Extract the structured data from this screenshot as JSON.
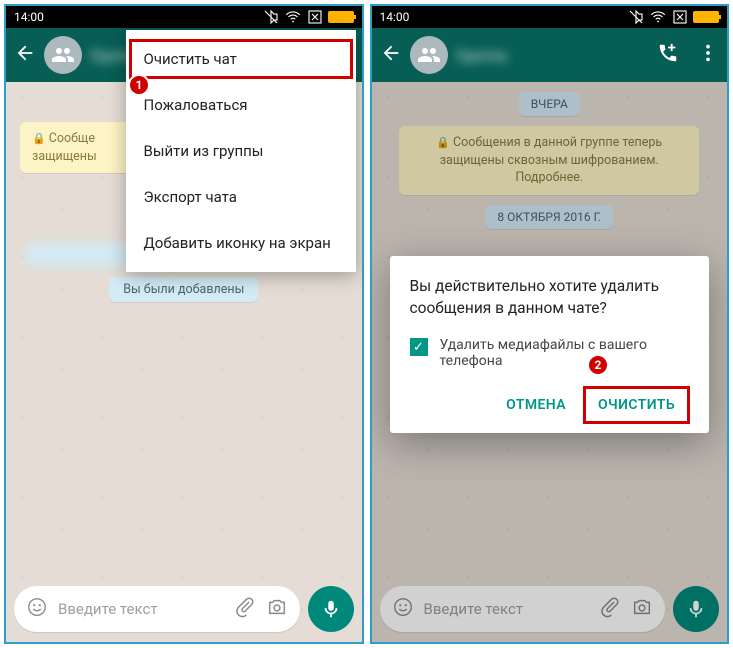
{
  "status": {
    "time": "14:00"
  },
  "appbar": {
    "title_placeholder": "Группа"
  },
  "menu": {
    "items": [
      "Очистить чат",
      "Пожаловаться",
      "Выйти из группы",
      "Экспорт чата",
      "Добавить иконку на экран"
    ]
  },
  "left": {
    "encryption_short": "Сообще защищены",
    "added_pill": "Вы были добавлены"
  },
  "right": {
    "date1": "ВЧЕРА",
    "encryption": "Сообщения в данной группе теперь защищены сквозным шифрованием. Подробнее.",
    "date2": "8 ОКТЯБРЯ 2016 Г."
  },
  "dialog": {
    "title": "Вы действительно хотите удалить сообщения в данном чате?",
    "checkbox": "Удалить медиафайлы с вашего телефона",
    "cancel": "ОТМЕНА",
    "confirm": "ОЧИСТИТЬ"
  },
  "input": {
    "placeholder": "Введите текст"
  },
  "callouts": {
    "one": "1",
    "two": "2"
  }
}
